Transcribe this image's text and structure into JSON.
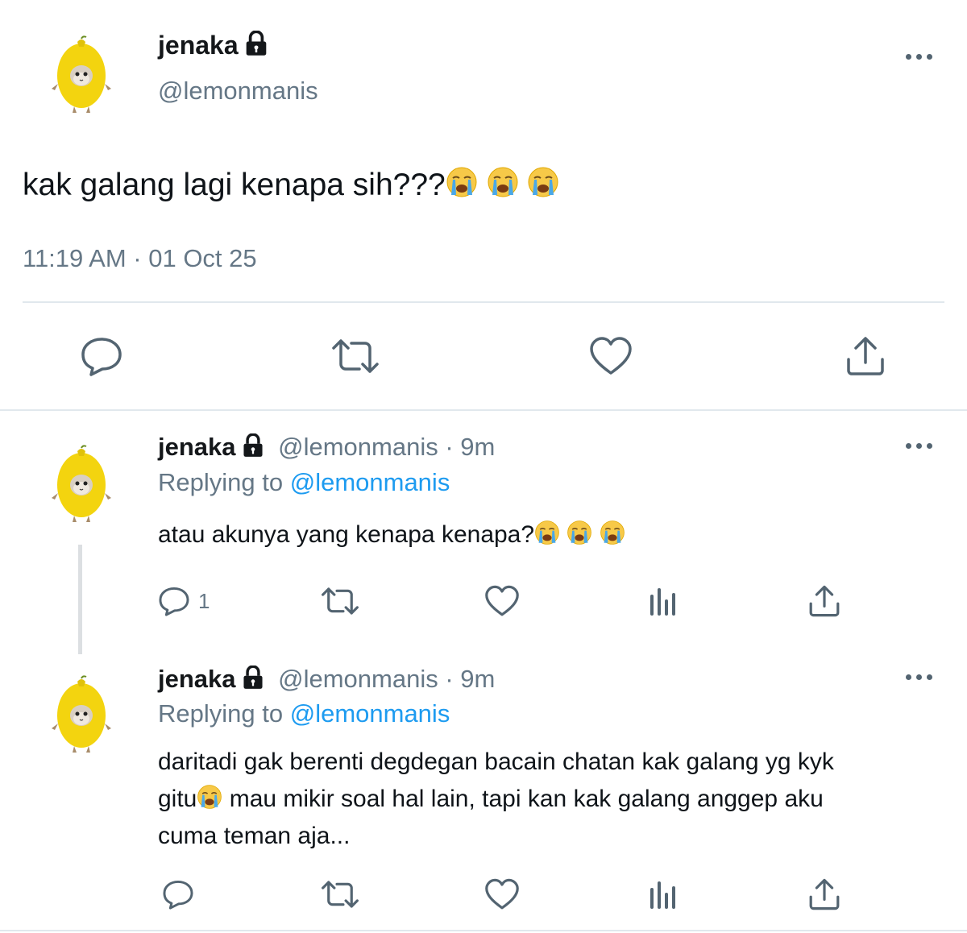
{
  "main_tweet": {
    "display_name": "jenaka",
    "handle": "@lemonmanis",
    "text": "kak galang lagi kenapa sih???",
    "text_emojis": [
      "loudly-crying-face",
      "loudly-crying-face",
      "loudly-crying-face"
    ],
    "timestamp": "11:19 AM · 01 Oct 25",
    "actions": [
      "reply",
      "retweet",
      "like",
      "share"
    ]
  },
  "replies": [
    {
      "display_name": "jenaka",
      "handle": "@lemonmanis",
      "time": "· 9m",
      "replying_prefix": "Replying to",
      "replying_handle": "@lemonmanis",
      "text": "atau akunya yang kenapa kenapa?",
      "text_emojis": [
        "loudly-crying-face",
        "loudly-crying-face",
        "loudly-crying-face"
      ],
      "reply_count": "1"
    },
    {
      "display_name": "jenaka",
      "handle": "@lemonmanis",
      "time": "· 9m",
      "replying_prefix": "Replying to",
      "replying_handle": "@lemonmanis",
      "text_line1": "daritadi gak berenti degdegan bacain chatan kak galang yg kyk",
      "text_line2_a": "gitu",
      "text_line2_b": " mau mikir soal hal lain, tapi kan kak galang anggep aku",
      "text_line3": "cuma teman aja...",
      "reply_count": ""
    }
  ],
  "colors": {
    "icon": "#536471",
    "link": "#1d9bf0",
    "muted": "#657786",
    "divider": "#e1e8ed",
    "avatar_lemon": "#f5d90a"
  }
}
